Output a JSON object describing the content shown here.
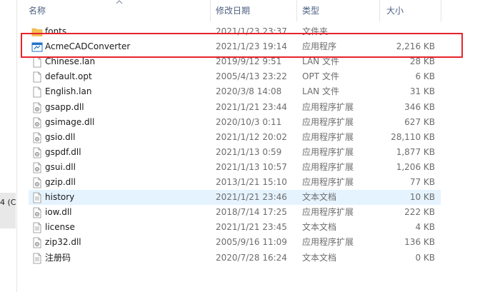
{
  "left_fragment": "4 (C",
  "columns": {
    "name": "名称",
    "date": "修改日期",
    "type": "类型",
    "size": "大小"
  },
  "files": [
    {
      "name": "fonts",
      "date": "2021/1/23 23:37",
      "type": "文件夹",
      "size": "",
      "icon": "folder-icon"
    },
    {
      "name": "AcmeCADConverter",
      "date": "2021/1/23 19:14",
      "type": "应用程序",
      "size": "2,216 KB",
      "icon": "app-icon"
    },
    {
      "name": "Chinese.lan",
      "date": "2019/9/12 9:51",
      "type": "LAN 文件",
      "size": "28 KB",
      "icon": "file-icon"
    },
    {
      "name": "default.opt",
      "date": "2005/4/13 23:22",
      "type": "OPT 文件",
      "size": "6 KB",
      "icon": "file-icon"
    },
    {
      "name": "English.lan",
      "date": "2020/3/8 14:08",
      "type": "LAN 文件",
      "size": "31 KB",
      "icon": "file-icon"
    },
    {
      "name": "gsapp.dll",
      "date": "2021/1/21 23:44",
      "type": "应用程序扩展",
      "size": "346 KB",
      "icon": "dll-icon"
    },
    {
      "name": "gsimage.dll",
      "date": "2020/10/3 0:11",
      "type": "应用程序扩展",
      "size": "627 KB",
      "icon": "dll-icon"
    },
    {
      "name": "gsio.dll",
      "date": "2021/1/12 20:02",
      "type": "应用程序扩展",
      "size": "28,110 KB",
      "icon": "dll-icon"
    },
    {
      "name": "gspdf.dll",
      "date": "2021/1/13 0:59",
      "type": "应用程序扩展",
      "size": "1,877 KB",
      "icon": "dll-icon"
    },
    {
      "name": "gsui.dll",
      "date": "2021/1/13 10:57",
      "type": "应用程序扩展",
      "size": "1,206 KB",
      "icon": "dll-icon"
    },
    {
      "name": "gzip.dll",
      "date": "2013/1/21 15:10",
      "type": "应用程序扩展",
      "size": "77 KB",
      "icon": "dll-icon"
    },
    {
      "name": "history",
      "date": "2021/1/21 23:46",
      "type": "文本文档",
      "size": "10 KB",
      "icon": "text-file-icon"
    },
    {
      "name": "iow.dll",
      "date": "2018/7/14 17:25",
      "type": "应用程序扩展",
      "size": "222 KB",
      "icon": "dll-icon"
    },
    {
      "name": "license",
      "date": "2021/1/21 23:45",
      "type": "文本文档",
      "size": "4 KB",
      "icon": "text-file-icon"
    },
    {
      "name": "zip32.dll",
      "date": "2005/9/16 11:09",
      "type": "应用程序扩展",
      "size": "136 KB",
      "icon": "dll-icon"
    },
    {
      "name": "注册码",
      "date": "2020/7/28 16:24",
      "type": "文本文档",
      "size": "0 KB",
      "icon": "text-file-icon"
    }
  ],
  "colors": {
    "header_text": "#4d6082",
    "hover_row": "#e5f3ff",
    "annotation_box": "#e8232a",
    "folder": "#f5c150",
    "app_icon": "#1e73c8"
  }
}
